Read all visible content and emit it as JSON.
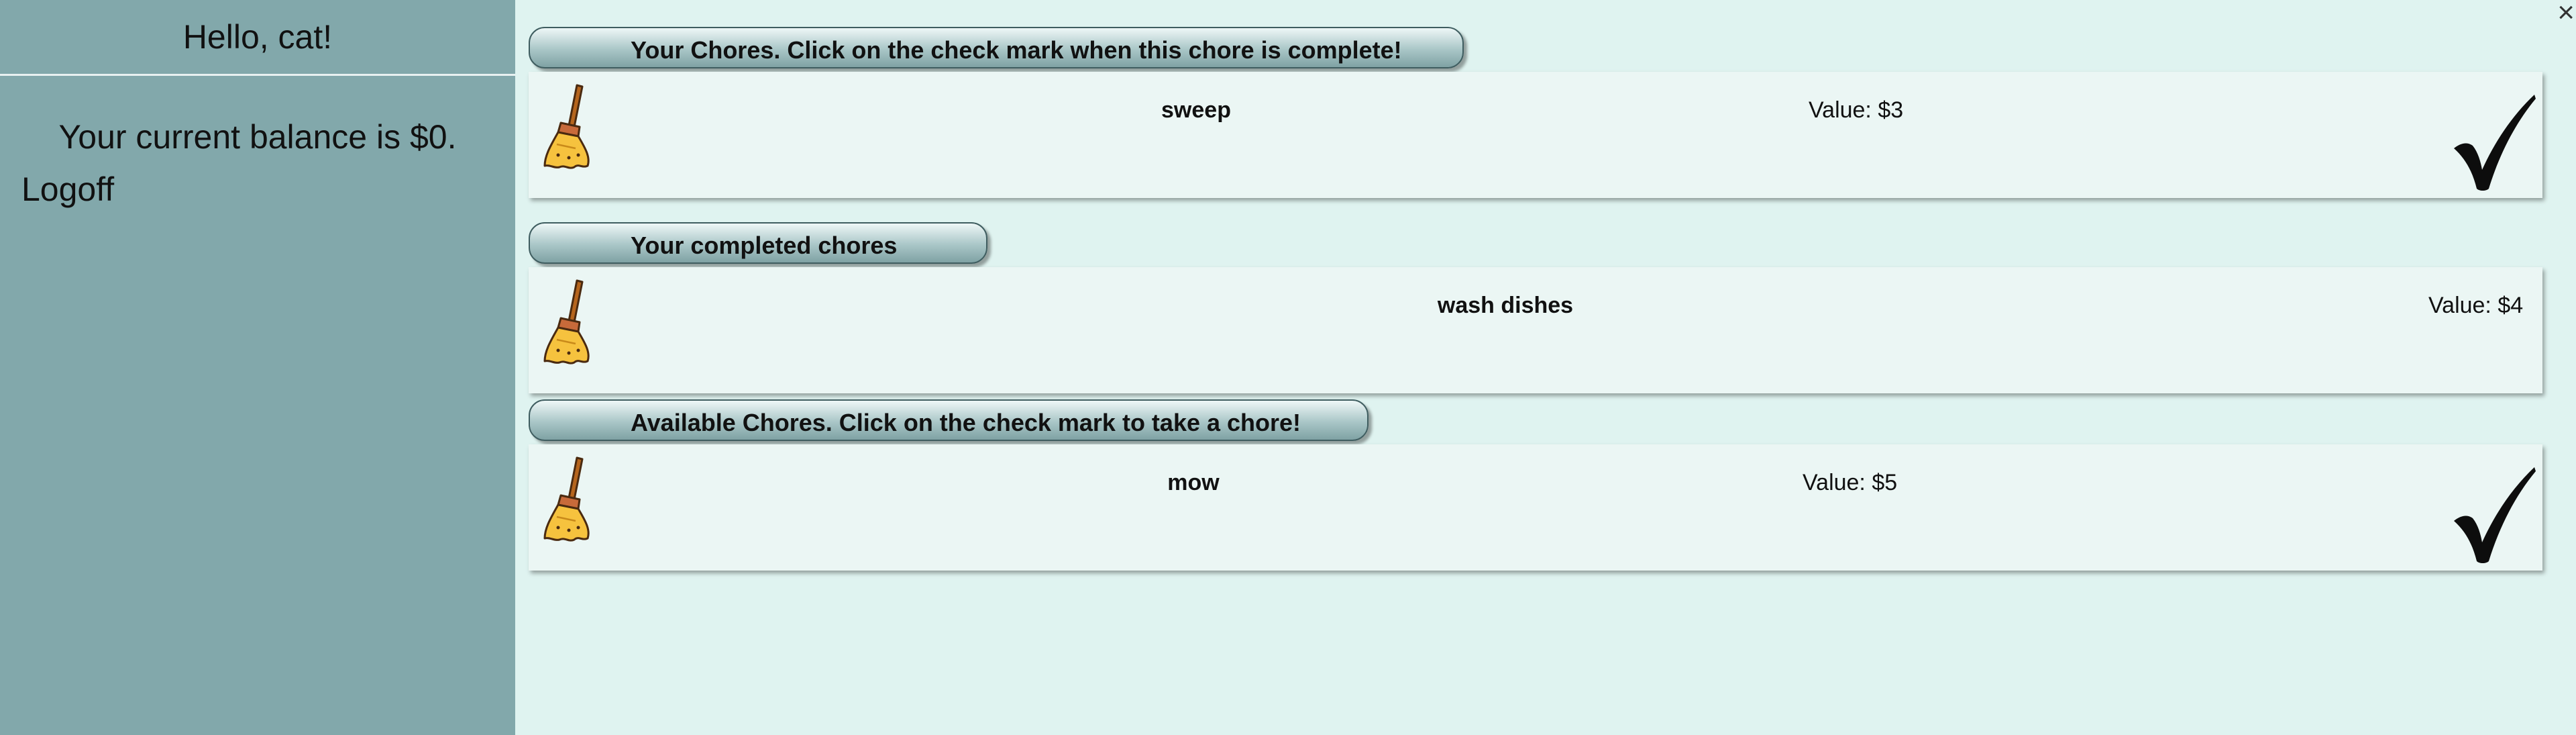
{
  "sidebar": {
    "greeting": "Hello, cat!",
    "balance": "Your current balance is $0.",
    "logoff": "Logoff"
  },
  "window": {
    "close_label": "×"
  },
  "sections": {
    "your_chores": {
      "header": "Your Chores. Click on the check mark when this chore is complete!",
      "items": [
        {
          "name": "sweep",
          "value": "Value: $3",
          "icon": "broom-icon",
          "action_icon": "check-mark-icon"
        }
      ]
    },
    "completed": {
      "header": "Your completed chores",
      "items": [
        {
          "name": "wash dishes",
          "value": "Value: $4",
          "icon": "broom-icon"
        }
      ]
    },
    "available": {
      "header": "Available Chores. Click on the check mark to take a chore!",
      "items": [
        {
          "name": "mow",
          "value": "Value: $5",
          "icon": "broom-icon",
          "action_icon": "check-mark-icon"
        }
      ]
    }
  },
  "colors": {
    "sidebar_bg": "#82a8ab",
    "main_bg": "#dff3f0",
    "card_bg": "#ebf6f4",
    "broom_bristles": "#f6c23e",
    "broom_handle": "#b5651d"
  }
}
